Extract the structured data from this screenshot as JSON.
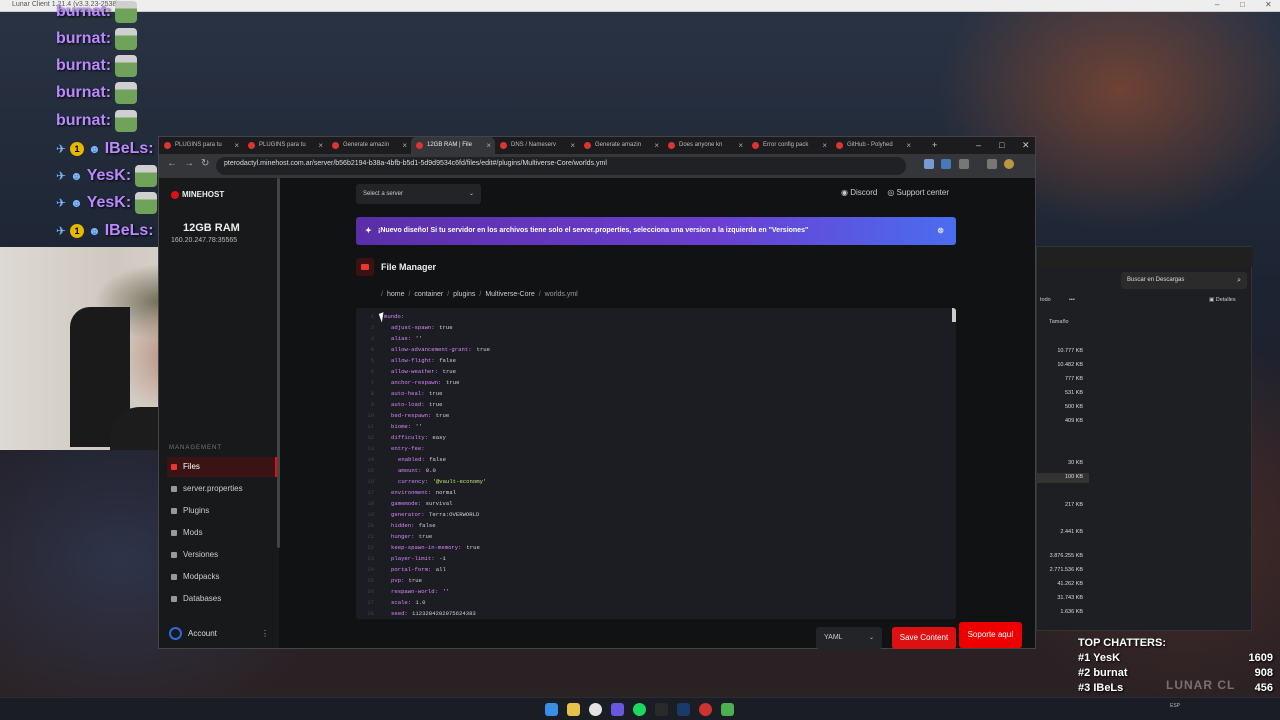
{
  "app": {
    "title": "Lunar Client 1.21.4 (v3.3.23-2538)"
  },
  "chat": {
    "lines": [
      {
        "user": "burnat:",
        "badges": false
      },
      {
        "user": "burnat:",
        "badges": false
      },
      {
        "user": "burnat:",
        "badges": false
      },
      {
        "user": "burnat:",
        "badges": false
      },
      {
        "user": "burnat:",
        "badges": false
      },
      {
        "user": "IBeLs:",
        "badges": true,
        "coin": "1"
      },
      {
        "user": "YesK:",
        "badges": true,
        "coin": ""
      },
      {
        "user": "YesK:",
        "badges": true,
        "coin": ""
      },
      {
        "user": "IBeLs:",
        "badges": true,
        "coin": "1"
      }
    ]
  },
  "browser": {
    "tabs": [
      {
        "label": "PLUGINS para tu",
        "active": false
      },
      {
        "label": "PLUGINS para tu",
        "active": false
      },
      {
        "label": "Generate amazin",
        "active": false
      },
      {
        "label": "12GB RAM | File",
        "active": true
      },
      {
        "label": "DNS / Nameserv",
        "active": false
      },
      {
        "label": "Generate amazin",
        "active": false
      },
      {
        "label": "Does anyone kn",
        "active": false
      },
      {
        "label": "Error config pack",
        "active": false
      },
      {
        "label": "GitHub - Polyhed",
        "active": false
      }
    ],
    "url": "pterodactyl.minehost.com.ar/server/b56b2194-b38a-4bfb-b5d1-5d9d9534c6fd/files/edit#/plugins/Multiverse-Core/worlds.yml"
  },
  "sidebar": {
    "logo": "MINEHOST",
    "server_name": "12GB RAM",
    "ip": "160.20.247.78:35565",
    "section": "MANAGEMENT",
    "items": [
      {
        "label": "Files",
        "active": true
      },
      {
        "label": "server.properties",
        "active": false
      },
      {
        "label": "Plugins",
        "active": false
      },
      {
        "label": "Mods",
        "active": false
      },
      {
        "label": "Versiones",
        "active": false
      },
      {
        "label": "Modpacks",
        "active": false
      },
      {
        "label": "Databases",
        "active": false
      }
    ],
    "account": "Account"
  },
  "main": {
    "server_select": "Select a server",
    "discord": "Discord",
    "support": "Support center",
    "banner": "¡Nuevo diseño! Si tu servidor en los archivos tiene solo el server.properties, selecciona una version a la izquierda en \"Versiones\"",
    "title": "File Manager",
    "breadcrumb": [
      "home",
      "container",
      "plugins",
      "Multiverse-Core",
      "worlds.yml"
    ],
    "language": "YAML",
    "save": "Save Content"
  },
  "editor": {
    "lines": [
      {
        "n": "1",
        "indent": 0,
        "key": "mundo:",
        "val": "",
        "kind": "v"
      },
      {
        "n": "2",
        "indent": 1,
        "key": "adjust-spawn:",
        "val": "true",
        "kind": "v"
      },
      {
        "n": "3",
        "indent": 1,
        "key": "alias:",
        "val": "''",
        "kind": "v"
      },
      {
        "n": "4",
        "indent": 1,
        "key": "allow-advancement-grant:",
        "val": "true",
        "kind": "v"
      },
      {
        "n": "5",
        "indent": 1,
        "key": "allow-flight:",
        "val": "false",
        "kind": "v"
      },
      {
        "n": "6",
        "indent": 1,
        "key": "allow-weather:",
        "val": "true",
        "kind": "v"
      },
      {
        "n": "7",
        "indent": 1,
        "key": "anchor-respawn:",
        "val": "true",
        "kind": "v"
      },
      {
        "n": "8",
        "indent": 1,
        "key": "auto-heal:",
        "val": "true",
        "kind": "v"
      },
      {
        "n": "9",
        "indent": 1,
        "key": "auto-load:",
        "val": "true",
        "kind": "v"
      },
      {
        "n": "10",
        "indent": 1,
        "key": "bed-respawn:",
        "val": "true",
        "kind": "v"
      },
      {
        "n": "11",
        "indent": 1,
        "key": "biome:",
        "val": "''",
        "kind": "v"
      },
      {
        "n": "12",
        "indent": 1,
        "key": "difficulty:",
        "val": "easy",
        "kind": "v"
      },
      {
        "n": "13",
        "indent": 1,
        "key": "entry-fee:",
        "val": "",
        "kind": "v"
      },
      {
        "n": "14",
        "indent": 2,
        "key": "enabled:",
        "val": "false",
        "kind": "v"
      },
      {
        "n": "15",
        "indent": 2,
        "key": "amount:",
        "val": "0.0",
        "kind": "v"
      },
      {
        "n": "16",
        "indent": 2,
        "key": "currency:",
        "val": "'@vault-economy'",
        "kind": "s"
      },
      {
        "n": "17",
        "indent": 1,
        "key": "environment:",
        "val": "normal",
        "kind": "v"
      },
      {
        "n": "18",
        "indent": 1,
        "key": "gamemode:",
        "val": "survival",
        "kind": "v"
      },
      {
        "n": "19",
        "indent": 1,
        "key": "generator:",
        "val": "Terra:OVERWORLD",
        "kind": "v"
      },
      {
        "n": "20",
        "indent": 1,
        "key": "hidden:",
        "val": "false",
        "kind": "v"
      },
      {
        "n": "21",
        "indent": 1,
        "key": "hunger:",
        "val": "true",
        "kind": "v"
      },
      {
        "n": "22",
        "indent": 1,
        "key": "keep-spawn-in-memory:",
        "val": "true",
        "kind": "v"
      },
      {
        "n": "23",
        "indent": 1,
        "key": "player-limit:",
        "val": "-1",
        "kind": "v"
      },
      {
        "n": "24",
        "indent": 1,
        "key": "portal-form:",
        "val": "all",
        "kind": "v"
      },
      {
        "n": "25",
        "indent": 1,
        "key": "pvp:",
        "val": "true",
        "kind": "v"
      },
      {
        "n": "26",
        "indent": 1,
        "key": "respawn-world:",
        "val": "''",
        "kind": "v"
      },
      {
        "n": "27",
        "indent": 1,
        "key": "scale:",
        "val": "1.0",
        "kind": "v"
      },
      {
        "n": "28",
        "indent": 1,
        "key": "seed:",
        "val": "1123284202975624383",
        "kind": "v"
      }
    ]
  },
  "support_button": "Soporte aquí",
  "explorer": {
    "search": "Buscar en Descargas",
    "toolbar_left": "todo",
    "toolbar_more": "•••",
    "details": "Detalles",
    "col_size": "Tamaño",
    "sizes": [
      "10.777 KB",
      "10.482 KB",
      "777 KB",
      "531 KB",
      "500 KB",
      "409 KB",
      "30 KB",
      "100 KB",
      "217 KB",
      "2.441 KB",
      "3.876.255 KB",
      "2.771.536 KB",
      "41.262 KB",
      "31.743 KB",
      "1.636 KB"
    ]
  },
  "top_chatters": {
    "title": "TOP CHATTERS:",
    "rows": [
      {
        "rank": "#1",
        "name": "YesK",
        "count": "1609"
      },
      {
        "rank": "#2",
        "name": "burnat",
        "count": "908"
      },
      {
        "rank": "#3",
        "name": "IBeLs",
        "count": "456"
      }
    ]
  },
  "watermark": "LUNAR CL",
  "colors": {
    "accent_red": "#dd1111",
    "banner_purple": "#6a3fd0",
    "yaml_key": "#d987ff",
    "yaml_string": "#c5e478"
  }
}
